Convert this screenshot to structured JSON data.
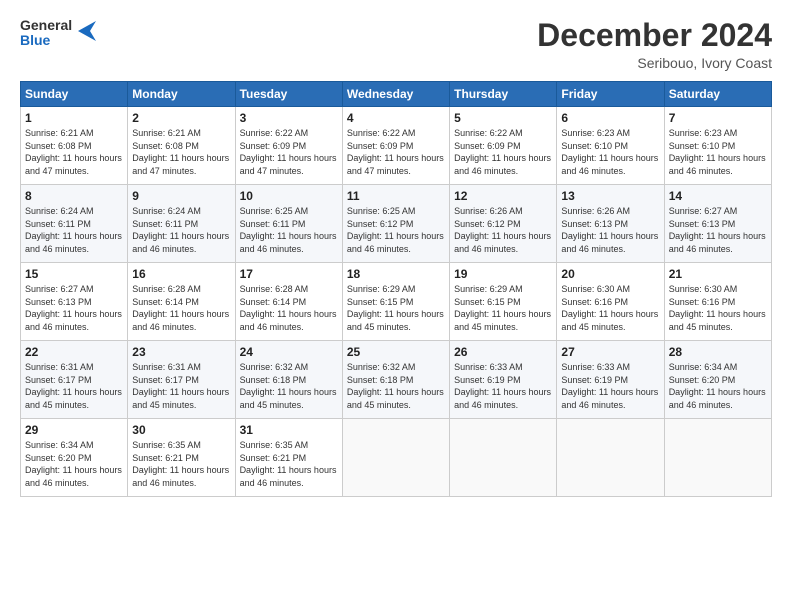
{
  "header": {
    "logo_general": "General",
    "logo_blue": "Blue",
    "title": "December 2024",
    "subtitle": "Seribouo, Ivory Coast"
  },
  "days_of_week": [
    "Sunday",
    "Monday",
    "Tuesday",
    "Wednesday",
    "Thursday",
    "Friday",
    "Saturday"
  ],
  "weeks": [
    [
      {
        "day": "1",
        "sunrise": "6:21 AM",
        "sunset": "6:08 PM",
        "daylight": "11 hours and 47 minutes."
      },
      {
        "day": "2",
        "sunrise": "6:21 AM",
        "sunset": "6:08 PM",
        "daylight": "11 hours and 47 minutes."
      },
      {
        "day": "3",
        "sunrise": "6:22 AM",
        "sunset": "6:09 PM",
        "daylight": "11 hours and 47 minutes."
      },
      {
        "day": "4",
        "sunrise": "6:22 AM",
        "sunset": "6:09 PM",
        "daylight": "11 hours and 47 minutes."
      },
      {
        "day": "5",
        "sunrise": "6:22 AM",
        "sunset": "6:09 PM",
        "daylight": "11 hours and 46 minutes."
      },
      {
        "day": "6",
        "sunrise": "6:23 AM",
        "sunset": "6:10 PM",
        "daylight": "11 hours and 46 minutes."
      },
      {
        "day": "7",
        "sunrise": "6:23 AM",
        "sunset": "6:10 PM",
        "daylight": "11 hours and 46 minutes."
      }
    ],
    [
      {
        "day": "8",
        "sunrise": "6:24 AM",
        "sunset": "6:11 PM",
        "daylight": "11 hours and 46 minutes."
      },
      {
        "day": "9",
        "sunrise": "6:24 AM",
        "sunset": "6:11 PM",
        "daylight": "11 hours and 46 minutes."
      },
      {
        "day": "10",
        "sunrise": "6:25 AM",
        "sunset": "6:11 PM",
        "daylight": "11 hours and 46 minutes."
      },
      {
        "day": "11",
        "sunrise": "6:25 AM",
        "sunset": "6:12 PM",
        "daylight": "11 hours and 46 minutes."
      },
      {
        "day": "12",
        "sunrise": "6:26 AM",
        "sunset": "6:12 PM",
        "daylight": "11 hours and 46 minutes."
      },
      {
        "day": "13",
        "sunrise": "6:26 AM",
        "sunset": "6:13 PM",
        "daylight": "11 hours and 46 minutes."
      },
      {
        "day": "14",
        "sunrise": "6:27 AM",
        "sunset": "6:13 PM",
        "daylight": "11 hours and 46 minutes."
      }
    ],
    [
      {
        "day": "15",
        "sunrise": "6:27 AM",
        "sunset": "6:13 PM",
        "daylight": "11 hours and 46 minutes."
      },
      {
        "day": "16",
        "sunrise": "6:28 AM",
        "sunset": "6:14 PM",
        "daylight": "11 hours and 46 minutes."
      },
      {
        "day": "17",
        "sunrise": "6:28 AM",
        "sunset": "6:14 PM",
        "daylight": "11 hours and 46 minutes."
      },
      {
        "day": "18",
        "sunrise": "6:29 AM",
        "sunset": "6:15 PM",
        "daylight": "11 hours and 45 minutes."
      },
      {
        "day": "19",
        "sunrise": "6:29 AM",
        "sunset": "6:15 PM",
        "daylight": "11 hours and 45 minutes."
      },
      {
        "day": "20",
        "sunrise": "6:30 AM",
        "sunset": "6:16 PM",
        "daylight": "11 hours and 45 minutes."
      },
      {
        "day": "21",
        "sunrise": "6:30 AM",
        "sunset": "6:16 PM",
        "daylight": "11 hours and 45 minutes."
      }
    ],
    [
      {
        "day": "22",
        "sunrise": "6:31 AM",
        "sunset": "6:17 PM",
        "daylight": "11 hours and 45 minutes."
      },
      {
        "day": "23",
        "sunrise": "6:31 AM",
        "sunset": "6:17 PM",
        "daylight": "11 hours and 45 minutes."
      },
      {
        "day": "24",
        "sunrise": "6:32 AM",
        "sunset": "6:18 PM",
        "daylight": "11 hours and 45 minutes."
      },
      {
        "day": "25",
        "sunrise": "6:32 AM",
        "sunset": "6:18 PM",
        "daylight": "11 hours and 45 minutes."
      },
      {
        "day": "26",
        "sunrise": "6:33 AM",
        "sunset": "6:19 PM",
        "daylight": "11 hours and 46 minutes."
      },
      {
        "day": "27",
        "sunrise": "6:33 AM",
        "sunset": "6:19 PM",
        "daylight": "11 hours and 46 minutes."
      },
      {
        "day": "28",
        "sunrise": "6:34 AM",
        "sunset": "6:20 PM",
        "daylight": "11 hours and 46 minutes."
      }
    ],
    [
      {
        "day": "29",
        "sunrise": "6:34 AM",
        "sunset": "6:20 PM",
        "daylight": "11 hours and 46 minutes."
      },
      {
        "day": "30",
        "sunrise": "6:35 AM",
        "sunset": "6:21 PM",
        "daylight": "11 hours and 46 minutes."
      },
      {
        "day": "31",
        "sunrise": "6:35 AM",
        "sunset": "6:21 PM",
        "daylight": "11 hours and 46 minutes."
      },
      null,
      null,
      null,
      null
    ]
  ]
}
